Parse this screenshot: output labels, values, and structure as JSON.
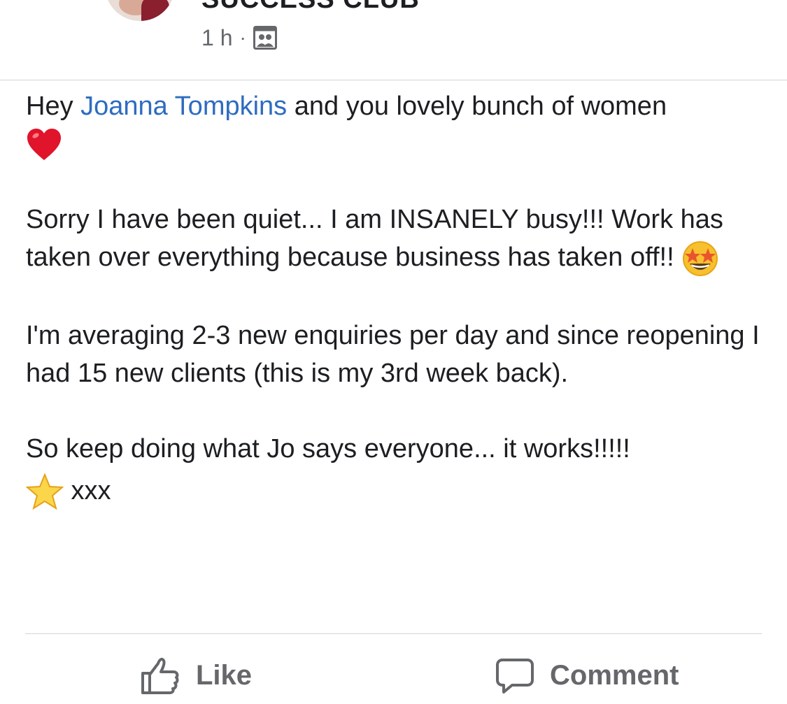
{
  "header": {
    "group_name": "SUCCESS CLUB",
    "time": "1 h",
    "separator": "·",
    "privacy_icon": "group-members-icon"
  },
  "post": {
    "greeting_prefix": "Hey ",
    "mention": "Joanna Tompkins",
    "greeting_suffix": " and you lovely bunch of women",
    "emoji_heart": "heart-emoji",
    "paragraph2": "Sorry I have been quiet... I am INSANELY busy!!! Work has taken over everything because business has taken off!! ",
    "emoji_star_struck": "star-struck-emoji",
    "paragraph3": "I'm averaging 2-3 new enquiries per day and since reopening I had 15 new clients (this is my 3rd week back).",
    "paragraph4": "So keep doing what Jo says everyone... it works!!!!!",
    "emoji_star": "star-emoji",
    "signoff": " xxx"
  },
  "actions": {
    "like_label": "Like",
    "like_icon": "thumbs-up-icon",
    "comment_label": "Comment",
    "comment_icon": "comment-bubble-icon"
  },
  "colors": {
    "mention": "#2d6cc0",
    "secondary_text": "#65676b",
    "divider": "#d4d4d6"
  }
}
